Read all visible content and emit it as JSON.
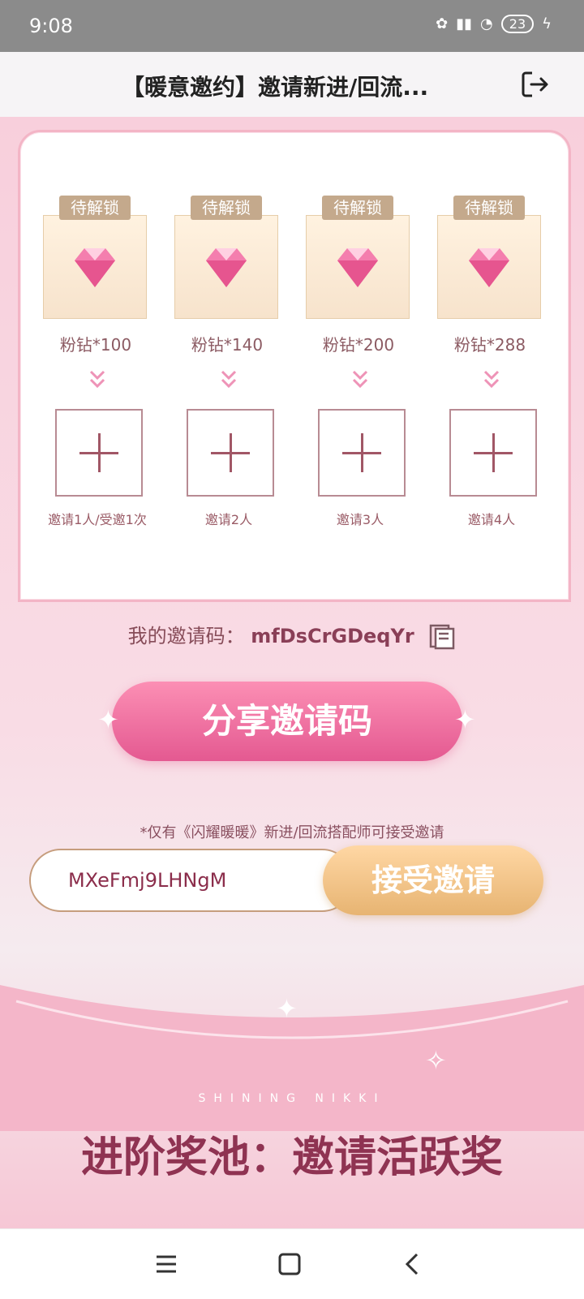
{
  "status": {
    "time": "9:08",
    "battery": "23"
  },
  "header": {
    "title": "【暖意邀约】邀请新进/回流..."
  },
  "rewards": [
    {
      "tag": "待解锁",
      "label": "粉钻*100",
      "condition": "邀请1人/受邀1次"
    },
    {
      "tag": "待解锁",
      "label": "粉钻*140",
      "condition": "邀请2人"
    },
    {
      "tag": "待解锁",
      "label": "粉钻*200",
      "condition": "邀请3人"
    },
    {
      "tag": "待解锁",
      "label": "粉钻*288",
      "condition": "邀请4人"
    }
  ],
  "invite": {
    "label": "我的邀请码：",
    "code": "mfDsCrGDeqYr"
  },
  "share_button": "分享邀请码",
  "note": "*仅有《闪耀暖暖》新进/回流搭配师可接受邀请",
  "accept": {
    "input_value": "MXeFmj9LHNgM",
    "button": "接受邀请"
  },
  "banner": {
    "subtitle": "SHINING NIKKI",
    "title": "进阶奖池：邀请活跃奖"
  }
}
